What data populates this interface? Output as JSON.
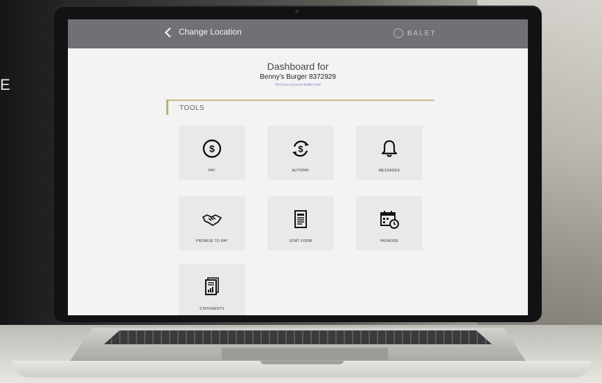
{
  "background": {
    "side_text": "E"
  },
  "app": {
    "back_label": "Change Location",
    "brand_label": "BALET"
  },
  "dashboard": {
    "title": "Dashboard for",
    "account": "Benny's Burger  8372929",
    "link_text": "Visit your account details here"
  },
  "tools": {
    "section_label": "TOOLS",
    "items": [
      {
        "label": "PAY",
        "icon": "dollar-circle-icon"
      },
      {
        "label": "AUTOPAY",
        "icon": "autopay-refresh-dollar-icon"
      },
      {
        "label": "MESSAGES",
        "icon": "bell-icon"
      },
      {
        "label": "PROMISE TO PAY",
        "icon": "handshake-icon"
      },
      {
        "label": "EFMT FORM",
        "icon": "document-form-icon"
      },
      {
        "label": "PAYMODE",
        "icon": "calendar-clock-icon"
      },
      {
        "label": "STATEMENTS",
        "icon": "statement-chart-icon"
      }
    ]
  },
  "colors": {
    "topbar": "#6f7174",
    "accent": "#c3ba86",
    "tile": "#e9e9e9"
  }
}
